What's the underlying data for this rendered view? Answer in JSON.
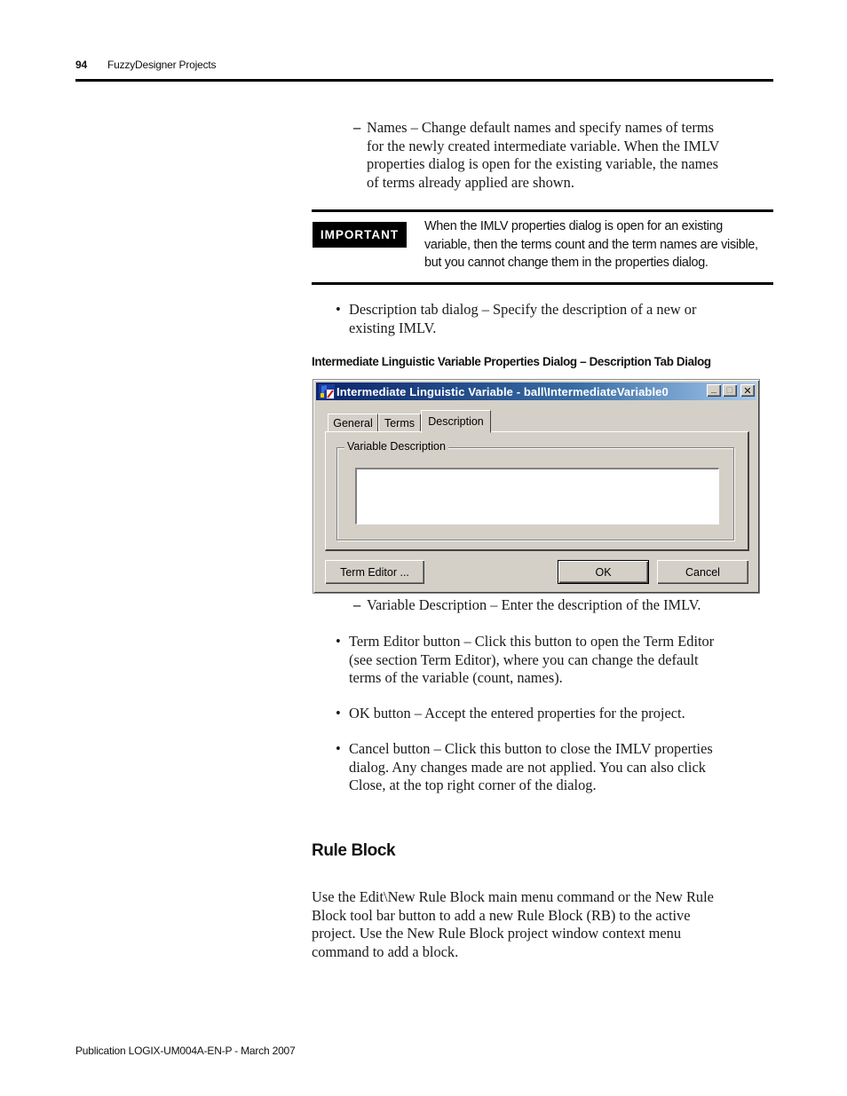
{
  "header": {
    "page_number": "94",
    "section_title": "FuzzyDesigner Projects"
  },
  "names_item": {
    "marker": "–",
    "lines": [
      "Names – Change default names and specify names of terms",
      "for the newly created intermediate variable. When the IMLV",
      "properties dialog is open for the existing variable, the names",
      "of terms already applied are shown."
    ]
  },
  "important": {
    "badge": "IMPORTANT",
    "lines": [
      "When the IMLV properties dialog is open for an existing",
      "variable, then the terms count and the term names are visible,",
      "but you cannot change them in the properties dialog."
    ]
  },
  "description_bullet": {
    "marker": "•",
    "lines": [
      "Description tab dialog – Specify the description of a new or",
      "existing IMLV."
    ]
  },
  "figure_caption": "Intermediate Linguistic Variable Properties Dialog – Description Tab Dialog",
  "dialog": {
    "title": "Intermediate Linguistic Variable - ball\\IntermediateVariable0",
    "app_icon": "fuzzy-designer-app-icon",
    "window_controls": {
      "minimize": "_",
      "maximize": "□",
      "close": "✕"
    },
    "tabs": [
      {
        "label": "General",
        "active": false
      },
      {
        "label": "Terms",
        "active": false
      },
      {
        "label": "Description",
        "active": true
      }
    ],
    "group_label": "Variable Description",
    "description_value": "",
    "buttons": {
      "term_editor": "Term Editor ...",
      "ok": "OK",
      "cancel": "Cancel"
    },
    "colors": {
      "titlebar_start": "#0a246a",
      "titlebar_end": "#a6caf0",
      "face": "#d4d0c8"
    }
  },
  "variable_description_item": {
    "marker": "–",
    "text": "Variable Description – Enter the description of the IMLV."
  },
  "term_editor_bullet": {
    "marker": "•",
    "lines": [
      "Term Editor button – Click this button to open the Term Editor",
      "(see section Term Editor), where you can change the default",
      "terms of the variable (count, names)."
    ]
  },
  "ok_bullet": {
    "marker": "•",
    "text": "OK button – Accept the entered properties for the project."
  },
  "cancel_bullet": {
    "marker": "•",
    "lines": [
      "Cancel button – Click this button to close the IMLV properties",
      "dialog. Any changes made are not applied. You can also click",
      "Close, at the top right corner of the dialog."
    ]
  },
  "rule_block": {
    "heading": "Rule Block",
    "lines": [
      "Use the Edit\\New Rule Block main menu command or the New Rule",
      "Block tool bar button to add a new Rule Block (RB) to the active",
      "project. Use the New Rule Block project window context menu",
      "command to add a block."
    ]
  },
  "footer": {
    "publication": "Publication LOGIX-UM004A-EN-P - March 2007"
  }
}
